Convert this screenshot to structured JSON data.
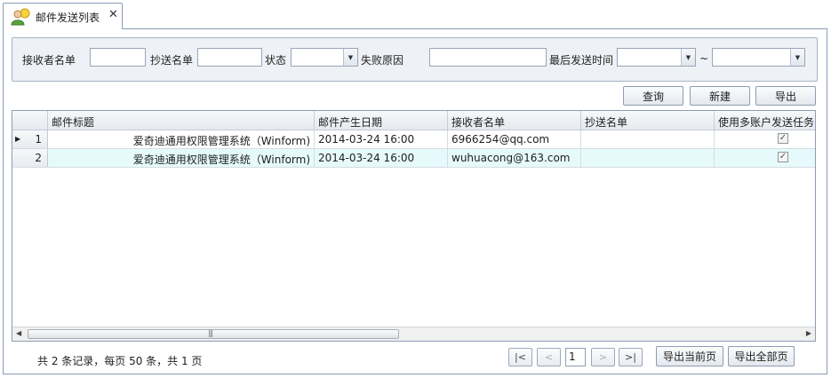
{
  "tab": {
    "title": "邮件发送列表",
    "close": "✕",
    "icon": "user-mail-icon"
  },
  "filter": {
    "receiver_label": "接收者名单",
    "receiver_value": "",
    "cc_label": "抄送名单",
    "cc_value": "",
    "status_label": "状态",
    "status_value": "",
    "fail_reason_label": "失败原因",
    "fail_reason_value": "",
    "last_send_time_label": "最后发送时间",
    "time_from_value": "",
    "time_to_value": "",
    "range_sep": "~"
  },
  "actions": {
    "query": "查询",
    "new": "新建",
    "export": "导出"
  },
  "grid": {
    "columns": [
      "邮件标题",
      "邮件产生日期",
      "接收者名单",
      "抄送名单",
      "使用多账户发送任务"
    ],
    "rows": [
      {
        "num": "1",
        "title": "爱奇迪通用权限管理系统（Winform)",
        "date": "2014-03-24 16:00",
        "receiver": "6966254@qq.com",
        "cc": "",
        "multi": true,
        "current": true
      },
      {
        "num": "2",
        "title": "爱奇迪通用权限管理系统（Winform)",
        "date": "2014-03-24 16:00",
        "receiver": "wuhuacong@163.com",
        "cc": "",
        "multi": true,
        "current": false
      }
    ]
  },
  "scroll": {
    "left": "◀",
    "right": "▶",
    "grip": "|||"
  },
  "pager": {
    "summary": "共 2 条记录，每页 50 条，共 1 页",
    "first": "|<",
    "prev": "<",
    "page": "1",
    "next": ">",
    "last": ">|",
    "export_current": "导出当前页",
    "export_all": "导出全部页"
  },
  "colors": {
    "border": "#8a9bb8",
    "alt_row": "#e6fafb",
    "panel": "#eef1f6"
  }
}
